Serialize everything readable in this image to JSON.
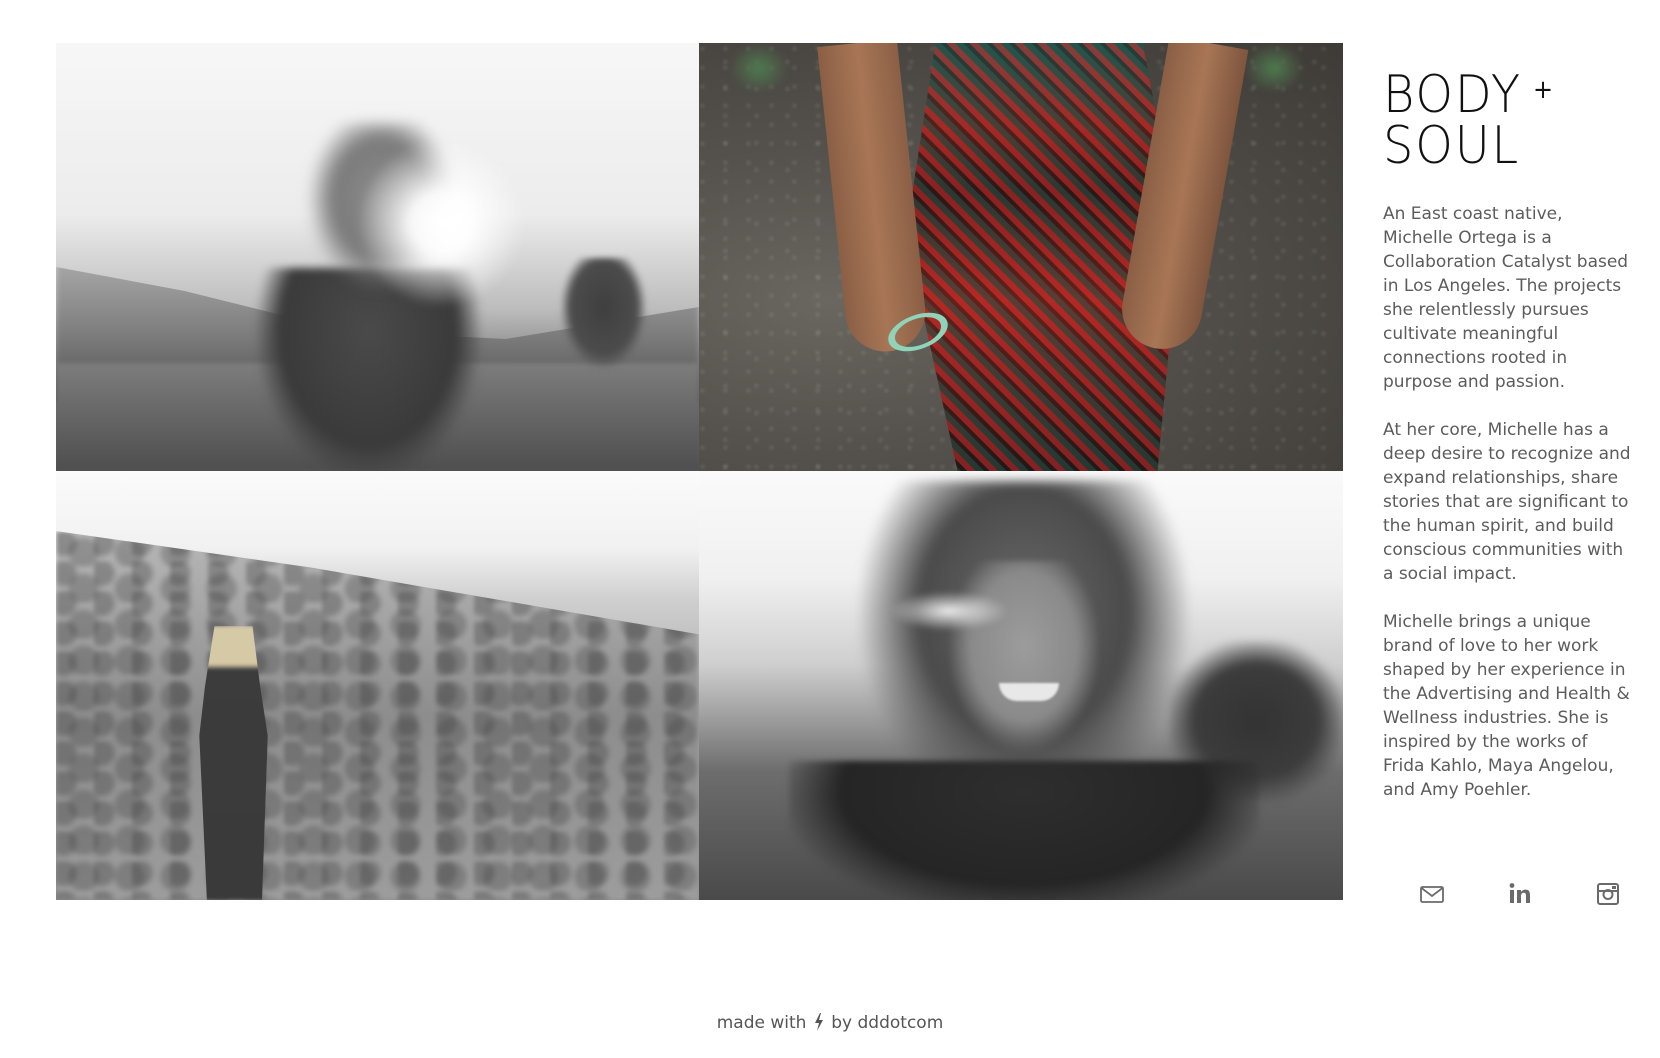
{
  "gallery": {
    "photos": [
      {
        "alt": "",
        "tone": "grayscale"
      },
      {
        "alt": "",
        "tone": "color"
      },
      {
        "alt": "",
        "tone": "grayscale"
      },
      {
        "alt": "",
        "tone": "grayscale"
      }
    ]
  },
  "sidebar": {
    "brand_line1": "BODY",
    "brand_plus": "+",
    "brand_line2": "SOUL",
    "bio": [
      "An East coast native, Michelle Ortega is a Collaboration Catalyst based in Los Angeles. The projects she relentlessly pursues cultivate meaningful connections rooted in purpose and passion.",
      "At her core, Michelle has a deep desire to recognize and expand relationships, share stories that are significant to the human spirit, and build conscious communities with a social impact.",
      "Michelle brings a unique brand of love to her work shaped by her experience in the Advertising and Health & Wellness industries. She is inspired by the works of Frida Kahlo, Maya Angelou, and Amy Poehler."
    ],
    "social": [
      {
        "icon": "mail-icon"
      },
      {
        "icon": "linkedin-icon"
      },
      {
        "icon": "instagram-icon"
      }
    ]
  },
  "footer": {
    "prefix": "made with",
    "icon": "lightning-bolt-icon",
    "middle": "by",
    "link": "dddotcom"
  },
  "colors": {
    "background": "#ffffff",
    "text": "#5c5c5c",
    "brand": "#111111",
    "icon": "#6a6a6a"
  }
}
